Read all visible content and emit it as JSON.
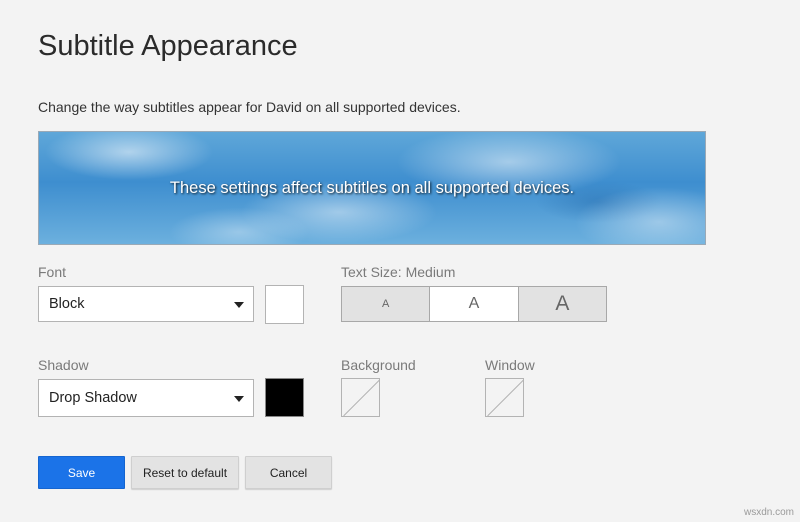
{
  "page": {
    "title": "Subtitle Appearance",
    "description": "Change the way subtitles appear for David on all supported devices."
  },
  "preview": {
    "text": "These settings affect subtitles on all supported devices."
  },
  "font": {
    "label": "Font",
    "selected": "Block",
    "color": "#ffffff"
  },
  "text_size": {
    "label": "Text Size: Medium",
    "options": [
      "A",
      "A",
      "A"
    ],
    "selected_index": 1
  },
  "shadow": {
    "label": "Shadow",
    "selected": "Drop Shadow",
    "color": "#000000"
  },
  "background": {
    "label": "Background"
  },
  "window": {
    "label": "Window"
  },
  "buttons": {
    "save": "Save",
    "reset": "Reset to default",
    "cancel": "Cancel"
  },
  "colors": {
    "accent": "#1b73e8",
    "page_bg": "#f3f3f3"
  },
  "watermark": "wsxdn.com"
}
